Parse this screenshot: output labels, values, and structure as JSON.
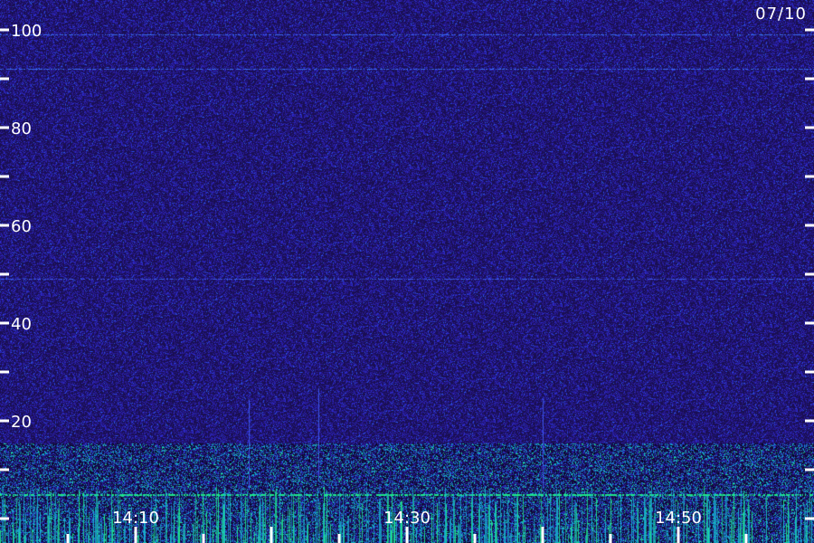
{
  "chart_data": {
    "type": "heatmap",
    "title": "",
    "xlabel": "",
    "ylabel": "",
    "date_label": "07/10",
    "ylim": [
      0,
      100
    ],
    "y_ticks_major": [
      20,
      40,
      60,
      80,
      100
    ],
    "y_tick_labels": [
      "20",
      "40",
      "60",
      "80",
      "100"
    ],
    "y_ticks_minor": [
      10,
      30,
      50,
      70,
      90
    ],
    "x_tick_labels": [
      "14:10",
      "14:30",
      "14:50"
    ],
    "x_range_minutes": [
      "14:00",
      "15:00"
    ],
    "x_tick_minutes": [
      10,
      30,
      50
    ],
    "x_minor_tick_every_minutes": 5,
    "background_color": "#1a0f52",
    "noise_color": "#2a22c8",
    "strong_signal_color": "#1ee68c",
    "medium_signal_color": "#18b4d2",
    "hum_lines_y": [
      99,
      92,
      49,
      5
    ],
    "active_band_y": [
      0,
      14
    ]
  }
}
